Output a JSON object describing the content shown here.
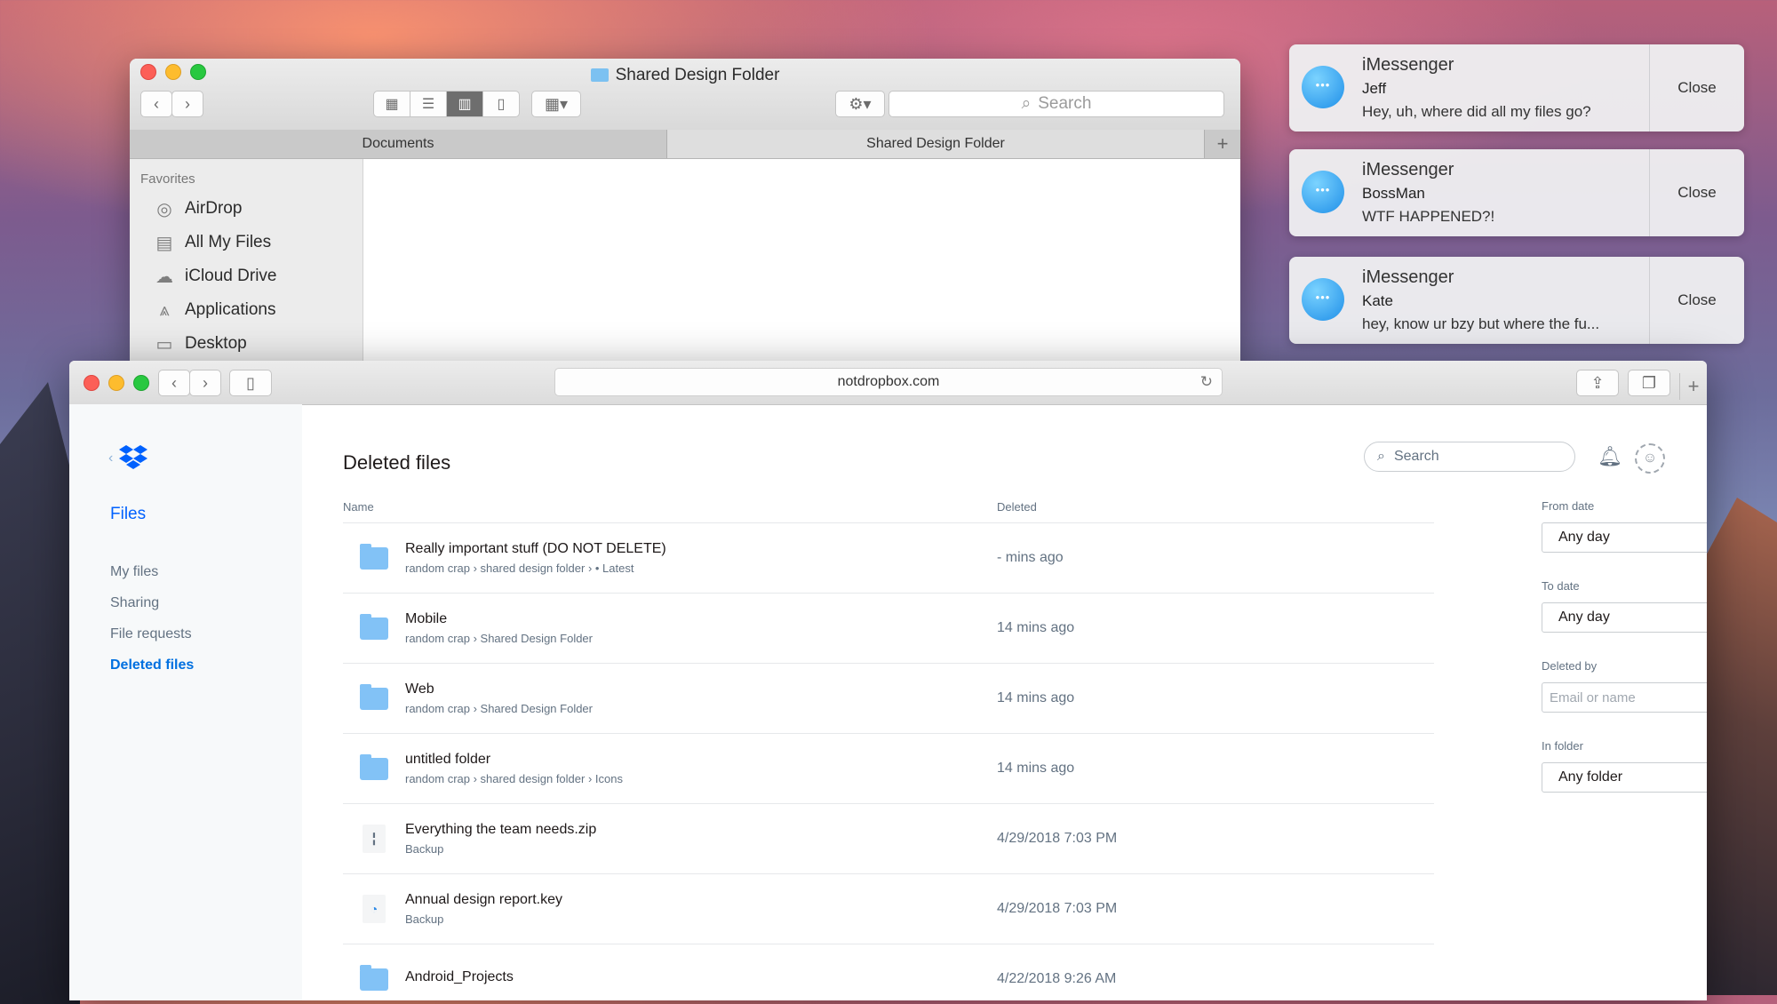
{
  "finder": {
    "title": "Shared Design Folder",
    "search_placeholder": "Search",
    "tabs": [
      "Documents",
      "Shared Design Folder"
    ],
    "favorites_heading": "Favorites",
    "favorites": [
      {
        "label": "AirDrop",
        "icon": "airdrop-icon"
      },
      {
        "label": "All My Files",
        "icon": "all-files-icon"
      },
      {
        "label": "iCloud Drive",
        "icon": "cloud-icon"
      },
      {
        "label": "Applications",
        "icon": "applications-icon"
      },
      {
        "label": "Desktop",
        "icon": "desktop-icon"
      }
    ]
  },
  "notifications": [
    {
      "app": "iMessenger",
      "from": "Jeff",
      "body": "Hey, uh, where did all my files go?",
      "close": "Close"
    },
    {
      "app": "iMessenger",
      "from": "BossMan",
      "body": "WTF HAPPENED?!",
      "close": "Close"
    },
    {
      "app": "iMessenger",
      "from": "Kate",
      "body": "hey, know ur bzy but where the fu...",
      "close": "Close"
    }
  ],
  "browser": {
    "url": "notdropbox.com"
  },
  "dropbox": {
    "sidebar": {
      "files_label": "Files",
      "nav": [
        "My files",
        "Sharing",
        "File requests",
        "Deleted files"
      ]
    },
    "page_title": "Deleted files",
    "search_placeholder": "Search",
    "columns": {
      "name": "Name",
      "deleted": "Deleted"
    },
    "rows": [
      {
        "name": "Really important stuff (DO NOT DELETE)",
        "path": "random crap › shared design folder › • Latest",
        "deleted": "- mins ago",
        "type": "folder"
      },
      {
        "name": "Mobile",
        "path": "random crap › Shared Design Folder",
        "deleted": "14 mins ago",
        "type": "folder"
      },
      {
        "name": "Web",
        "path": "random crap › Shared Design Folder",
        "deleted": "14 mins ago",
        "type": "folder"
      },
      {
        "name": "untitled folder",
        "path": "random crap › shared design folder › Icons",
        "deleted": "14 mins ago",
        "type": "folder"
      },
      {
        "name": "Everything the team needs.zip",
        "path": "Backup",
        "deleted": "4/29/2018 7:03 PM",
        "type": "zip"
      },
      {
        "name": "Annual design report.key",
        "path": "Backup",
        "deleted": "4/29/2018 7:03 PM",
        "type": "keynote"
      },
      {
        "name": "Android_Projects",
        "path": "",
        "deleted": "4/22/2018 9:26 AM",
        "type": "folder"
      }
    ],
    "filters": {
      "from_label": "From date",
      "from_value": "Any day",
      "to_label": "To date",
      "to_value": "Any day",
      "deleted_by_label": "Deleted by",
      "deleted_by_placeholder": "Email or name",
      "folder_label": "In folder",
      "folder_value": "Any folder"
    }
  }
}
